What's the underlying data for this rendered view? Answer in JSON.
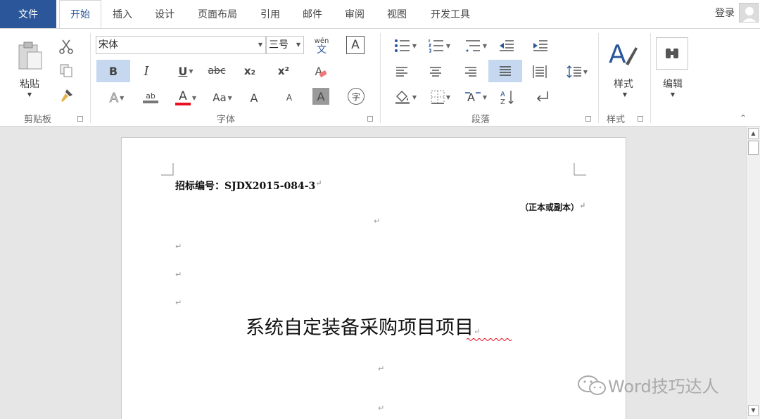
{
  "tabs": {
    "file": "文件",
    "home": "开始",
    "insert": "插入",
    "design": "设计",
    "layout": "页面布局",
    "references": "引用",
    "mailings": "邮件",
    "review": "审阅",
    "view": "视图",
    "developer": "开发工具"
  },
  "account": {
    "login": "登录"
  },
  "ribbon": {
    "clipboard": {
      "paste": "粘贴",
      "group": "剪贴板"
    },
    "font": {
      "name": "宋体",
      "size": "三号",
      "group": "字体",
      "bold": "B",
      "italic": "I",
      "underline": "U",
      "strike": "abc",
      "subscript": "x₂",
      "superscript": "x²",
      "phonetic_top": "wén",
      "phonetic_bottom": "文",
      "border_char": "A",
      "clear": "A",
      "effects": "A",
      "highlight": "ab",
      "color": "A",
      "case": "Aa",
      "grow": "A",
      "shrink": "A",
      "shading": "A",
      "enclose": "字"
    },
    "paragraph": {
      "group": "段落"
    },
    "styles": {
      "label": "样式",
      "group": "样式"
    },
    "editing": {
      "label": "编辑"
    }
  },
  "document": {
    "tender_no": "招标编号：SJDX2015-084-3",
    "copy_label": "（正本或副本）",
    "title": "系统自定装备采购项目项目"
  },
  "watermark": "Word技巧达人",
  "colors": {
    "accent": "#2b579a",
    "font_color_bar": "#e81123",
    "selected": "#c5d8ef"
  }
}
